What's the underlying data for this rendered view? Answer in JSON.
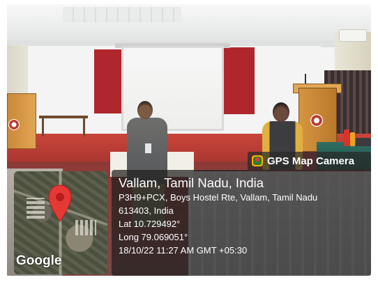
{
  "overlay": {
    "app_name": "GPS Map Camera",
    "place_title": "Vallam, Tamil Nadu, India",
    "address_line1": "P3H9+PCX, Boys Hostel Rte, Vallam, Tamil Nadu",
    "address_line2": "613403, India",
    "latitude": "Lat 10.729492°",
    "longitude": "Long 79.069051°",
    "datetime": "18/10/22 11:27 AM GMT +05:30"
  },
  "map": {
    "attribution": "Google",
    "pin_color": "#e53935"
  },
  "colors": {
    "stage_red": "#b0262d",
    "podium_wood": "#d69540",
    "overlay_bg": "#1e1e1e"
  }
}
